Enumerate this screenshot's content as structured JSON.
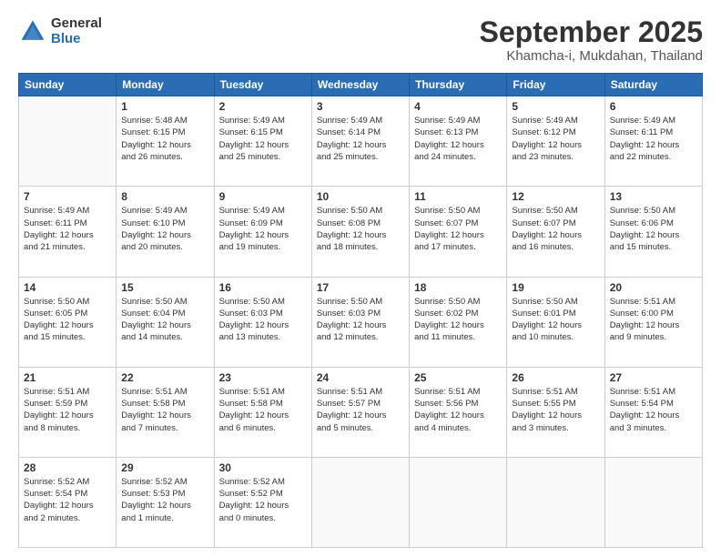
{
  "header": {
    "logo_general": "General",
    "logo_blue": "Blue",
    "month_title": "September 2025",
    "location": "Khamcha-i, Mukdahan, Thailand"
  },
  "days_of_week": [
    "Sunday",
    "Monday",
    "Tuesday",
    "Wednesday",
    "Thursday",
    "Friday",
    "Saturday"
  ],
  "weeks": [
    [
      {
        "day": "",
        "info": ""
      },
      {
        "day": "1",
        "info": "Sunrise: 5:48 AM\nSunset: 6:15 PM\nDaylight: 12 hours\nand 26 minutes."
      },
      {
        "day": "2",
        "info": "Sunrise: 5:49 AM\nSunset: 6:15 PM\nDaylight: 12 hours\nand 25 minutes."
      },
      {
        "day": "3",
        "info": "Sunrise: 5:49 AM\nSunset: 6:14 PM\nDaylight: 12 hours\nand 25 minutes."
      },
      {
        "day": "4",
        "info": "Sunrise: 5:49 AM\nSunset: 6:13 PM\nDaylight: 12 hours\nand 24 minutes."
      },
      {
        "day": "5",
        "info": "Sunrise: 5:49 AM\nSunset: 6:12 PM\nDaylight: 12 hours\nand 23 minutes."
      },
      {
        "day": "6",
        "info": "Sunrise: 5:49 AM\nSunset: 6:11 PM\nDaylight: 12 hours\nand 22 minutes."
      }
    ],
    [
      {
        "day": "7",
        "info": "Sunrise: 5:49 AM\nSunset: 6:11 PM\nDaylight: 12 hours\nand 21 minutes."
      },
      {
        "day": "8",
        "info": "Sunrise: 5:49 AM\nSunset: 6:10 PM\nDaylight: 12 hours\nand 20 minutes."
      },
      {
        "day": "9",
        "info": "Sunrise: 5:49 AM\nSunset: 6:09 PM\nDaylight: 12 hours\nand 19 minutes."
      },
      {
        "day": "10",
        "info": "Sunrise: 5:50 AM\nSunset: 6:08 PM\nDaylight: 12 hours\nand 18 minutes."
      },
      {
        "day": "11",
        "info": "Sunrise: 5:50 AM\nSunset: 6:07 PM\nDaylight: 12 hours\nand 17 minutes."
      },
      {
        "day": "12",
        "info": "Sunrise: 5:50 AM\nSunset: 6:07 PM\nDaylight: 12 hours\nand 16 minutes."
      },
      {
        "day": "13",
        "info": "Sunrise: 5:50 AM\nSunset: 6:06 PM\nDaylight: 12 hours\nand 15 minutes."
      }
    ],
    [
      {
        "day": "14",
        "info": "Sunrise: 5:50 AM\nSunset: 6:05 PM\nDaylight: 12 hours\nand 15 minutes."
      },
      {
        "day": "15",
        "info": "Sunrise: 5:50 AM\nSunset: 6:04 PM\nDaylight: 12 hours\nand 14 minutes."
      },
      {
        "day": "16",
        "info": "Sunrise: 5:50 AM\nSunset: 6:03 PM\nDaylight: 12 hours\nand 13 minutes."
      },
      {
        "day": "17",
        "info": "Sunrise: 5:50 AM\nSunset: 6:03 PM\nDaylight: 12 hours\nand 12 minutes."
      },
      {
        "day": "18",
        "info": "Sunrise: 5:50 AM\nSunset: 6:02 PM\nDaylight: 12 hours\nand 11 minutes."
      },
      {
        "day": "19",
        "info": "Sunrise: 5:50 AM\nSunset: 6:01 PM\nDaylight: 12 hours\nand 10 minutes."
      },
      {
        "day": "20",
        "info": "Sunrise: 5:51 AM\nSunset: 6:00 PM\nDaylight: 12 hours\nand 9 minutes."
      }
    ],
    [
      {
        "day": "21",
        "info": "Sunrise: 5:51 AM\nSunset: 5:59 PM\nDaylight: 12 hours\nand 8 minutes."
      },
      {
        "day": "22",
        "info": "Sunrise: 5:51 AM\nSunset: 5:58 PM\nDaylight: 12 hours\nand 7 minutes."
      },
      {
        "day": "23",
        "info": "Sunrise: 5:51 AM\nSunset: 5:58 PM\nDaylight: 12 hours\nand 6 minutes."
      },
      {
        "day": "24",
        "info": "Sunrise: 5:51 AM\nSunset: 5:57 PM\nDaylight: 12 hours\nand 5 minutes."
      },
      {
        "day": "25",
        "info": "Sunrise: 5:51 AM\nSunset: 5:56 PM\nDaylight: 12 hours\nand 4 minutes."
      },
      {
        "day": "26",
        "info": "Sunrise: 5:51 AM\nSunset: 5:55 PM\nDaylight: 12 hours\nand 3 minutes."
      },
      {
        "day": "27",
        "info": "Sunrise: 5:51 AM\nSunset: 5:54 PM\nDaylight: 12 hours\nand 3 minutes."
      }
    ],
    [
      {
        "day": "28",
        "info": "Sunrise: 5:52 AM\nSunset: 5:54 PM\nDaylight: 12 hours\nand 2 minutes."
      },
      {
        "day": "29",
        "info": "Sunrise: 5:52 AM\nSunset: 5:53 PM\nDaylight: 12 hours\nand 1 minute."
      },
      {
        "day": "30",
        "info": "Sunrise: 5:52 AM\nSunset: 5:52 PM\nDaylight: 12 hours\nand 0 minutes."
      },
      {
        "day": "",
        "info": ""
      },
      {
        "day": "",
        "info": ""
      },
      {
        "day": "",
        "info": ""
      },
      {
        "day": "",
        "info": ""
      }
    ]
  ]
}
